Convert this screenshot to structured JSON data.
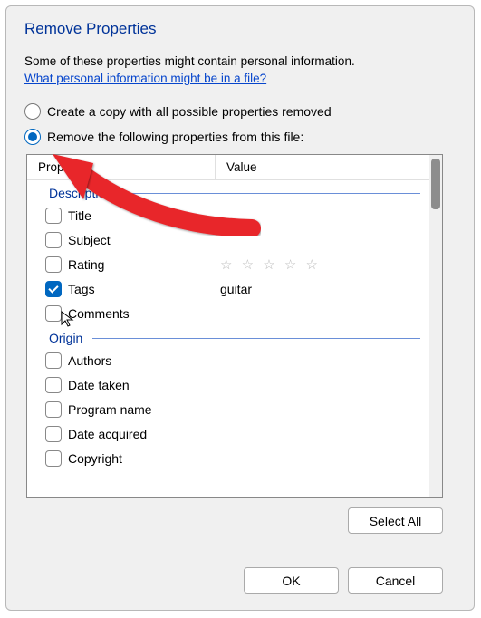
{
  "title": "Remove Properties",
  "description": "Some of these properties might contain personal information.",
  "link_text": "What personal information might be in a file?",
  "radio1_label": "Create a copy with all possible properties removed",
  "radio2_label": "Remove the following properties from this file:",
  "columns": {
    "property": "Property",
    "value": "Value"
  },
  "groups": [
    {
      "name": "Description",
      "items": [
        {
          "label": "Title",
          "value": "",
          "checked": false
        },
        {
          "label": "Subject",
          "value": "",
          "checked": false
        },
        {
          "label": "Rating",
          "value": "stars",
          "checked": false
        },
        {
          "label": "Tags",
          "value": "guitar",
          "checked": true
        },
        {
          "label": "Comments",
          "value": "",
          "checked": false
        }
      ]
    },
    {
      "name": "Origin",
      "items": [
        {
          "label": "Authors",
          "value": "",
          "checked": false
        },
        {
          "label": "Date taken",
          "value": "",
          "checked": false
        },
        {
          "label": "Program name",
          "value": "",
          "checked": false
        },
        {
          "label": "Date acquired",
          "value": "",
          "checked": false
        },
        {
          "label": "Copyright",
          "value": "",
          "checked": false
        }
      ]
    }
  ],
  "buttons": {
    "select_all": "Select All",
    "ok": "OK",
    "cancel": "Cancel"
  }
}
